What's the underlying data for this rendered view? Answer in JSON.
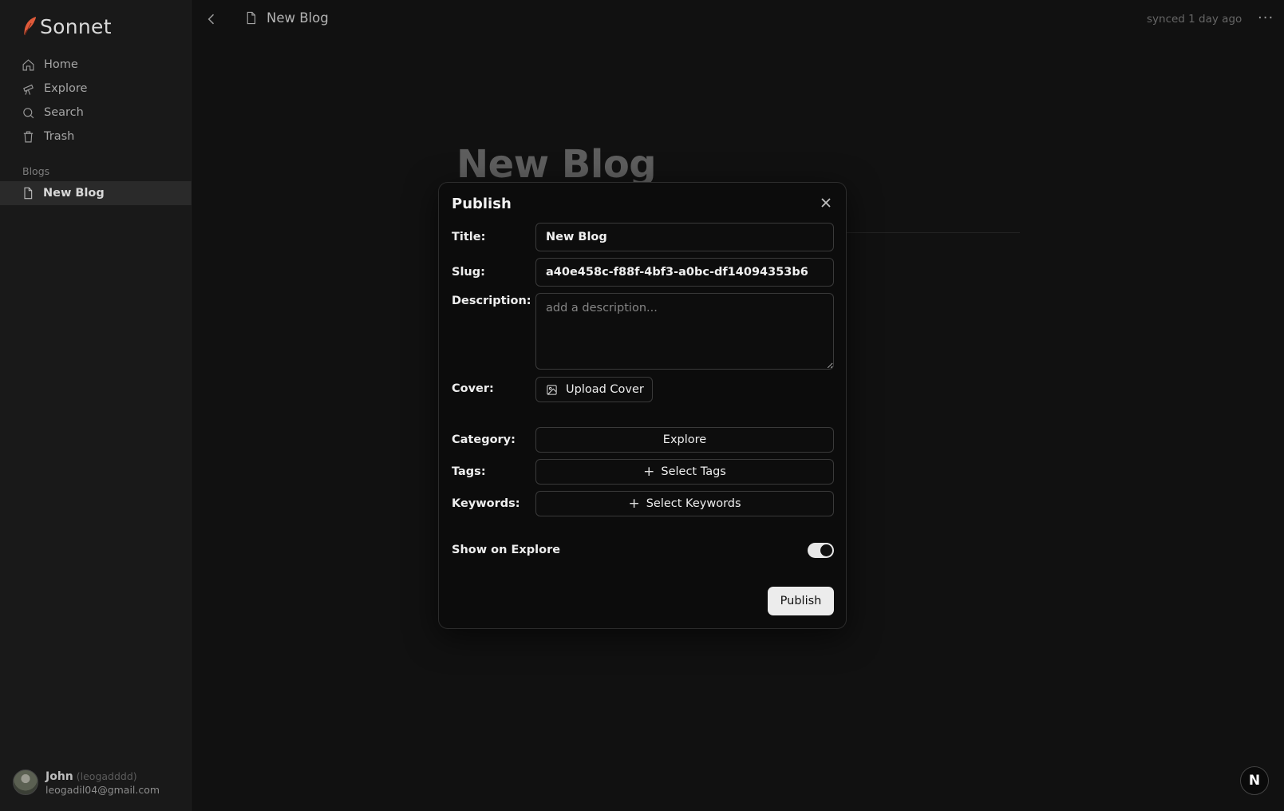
{
  "sidebar": {
    "brand": "Sonnet",
    "nav": [
      {
        "label": "Home",
        "icon": "home-icon"
      },
      {
        "label": "Explore",
        "icon": "telescope-icon"
      },
      {
        "label": "Search",
        "icon": "search-icon"
      },
      {
        "label": "Trash",
        "icon": "trash-icon"
      }
    ],
    "section_label": "Blogs",
    "blogs": [
      {
        "label": "New Blog",
        "icon": "file-icon"
      }
    ],
    "user": {
      "name": "John",
      "handle": "(leogadddd)",
      "email": "leogadil04@gmail.com"
    }
  },
  "header": {
    "breadcrumb": "New Blog",
    "sync_status": "synced 1 day ago",
    "more_label": "···"
  },
  "document": {
    "title": "New Blog"
  },
  "modal": {
    "title": "Publish",
    "fields": {
      "title_label": "Title:",
      "title_value": "New Blog",
      "slug_label": "Slug:",
      "slug_value": "a40e458c-f88f-4bf3-a0bc-df14094353b6",
      "description_label": "Description:",
      "description_placeholder": "add a description...",
      "cover_label": "Cover:",
      "upload_cover": "Upload Cover",
      "category_label": "Category:",
      "category_value": "Explore",
      "tags_label": "Tags:",
      "tags_button": "Select Tags",
      "keywords_label": "Keywords:",
      "keywords_button": "Select Keywords",
      "show_on_explore_label": "Show on Explore",
      "show_on_explore": true
    },
    "publish_button": "Publish"
  },
  "badge": {
    "letter": "N"
  },
  "colors": {
    "background": "#111111",
    "sidebar": "#191919",
    "accent": "#e05a3a"
  }
}
